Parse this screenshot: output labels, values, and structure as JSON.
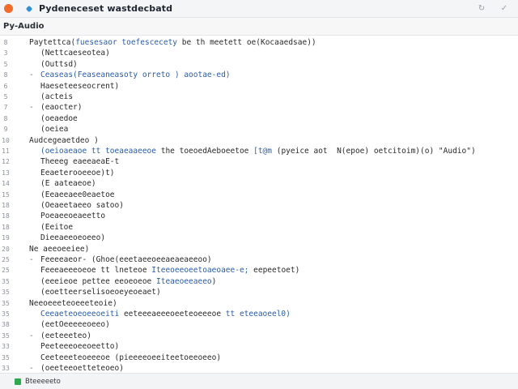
{
  "window": {
    "title": "Pydeneceset wastdecbatd",
    "refresh_glyph": "↻",
    "check_glyph": "✓"
  },
  "tab": {
    "label": "Py-Audio"
  },
  "editor": {
    "lines": [
      {
        "num": "8",
        "fold": "",
        "indent": 36,
        "segments": [
          {
            "t": "Paytettca(",
            "c": "plain"
          },
          {
            "t": "fuesesaor toefescecety",
            "c": "blue"
          },
          {
            "t": " be th meetett oe(Kocaaedsae))",
            "c": "plain"
          }
        ]
      },
      {
        "num": "3",
        "fold": "",
        "indent": 50,
        "segments": [
          {
            "t": "(Nettcaeseotea)",
            "c": "plain"
          }
        ]
      },
      {
        "num": "5",
        "fold": "",
        "indent": 50,
        "segments": [
          {
            "t": "(Outtsd)",
            "c": "plain"
          }
        ]
      },
      {
        "num": "8",
        "fold": "-",
        "indent": 50,
        "segments": [
          {
            "t": "Ceaseas(Feaseaneasoty orreto )",
            "c": "blue"
          },
          {
            "t": " ",
            "c": "plain"
          },
          {
            "t": "aootae-ed)",
            "c": "blue"
          }
        ]
      },
      {
        "num": "6",
        "fold": "",
        "indent": 50,
        "segments": [
          {
            "t": "Haeseteeseocrent)",
            "c": "plain"
          }
        ]
      },
      {
        "num": "5",
        "fold": "",
        "indent": 50,
        "segments": [
          {
            "t": "(acteis",
            "c": "plain"
          }
        ]
      },
      {
        "num": "7",
        "fold": "-",
        "indent": 50,
        "segments": [
          {
            "t": "(eaocter)",
            "c": "plain"
          }
        ]
      },
      {
        "num": "8",
        "fold": "",
        "indent": 50,
        "segments": [
          {
            "t": "(oeaedoe",
            "c": "plain"
          }
        ]
      },
      {
        "num": "9",
        "fold": "",
        "indent": 50,
        "segments": [
          {
            "t": "(oeiea",
            "c": "plain"
          }
        ]
      },
      {
        "num": "10",
        "fold": "",
        "indent": 36,
        "segments": [
          {
            "t": "Audcegeaetdeo )",
            "c": "plain"
          }
        ]
      },
      {
        "num": "11",
        "fold": "",
        "indent": 50,
        "segments": [
          {
            "t": "(oeioaeaoe tt toeaeaaeeoe",
            "c": "blue"
          },
          {
            "t": " the toeoedAeboeetoe",
            "c": "plain"
          },
          {
            "t": " [t@m",
            "c": "blue"
          },
          {
            "t": " (pyeice aot  N(epoe) oetcitoim)(o)",
            "c": "plain"
          },
          {
            "t": " \"Audio\")",
            "c": "plain"
          }
        ]
      },
      {
        "num": "12",
        "fold": "",
        "indent": 50,
        "segments": [
          {
            "t": "Theeeg eaeeaeaE-t",
            "c": "plain"
          }
        ]
      },
      {
        "num": "13",
        "fold": "",
        "indent": 50,
        "segments": [
          {
            "t": "Eeaeterooeeoe)t)",
            "c": "plain"
          }
        ]
      },
      {
        "num": "14",
        "fold": "",
        "indent": 50,
        "segments": [
          {
            "t": "(E aateaeoe)",
            "c": "plain"
          }
        ]
      },
      {
        "num": "15",
        "fold": "",
        "indent": 50,
        "segments": [
          {
            "t": "(Eeaeeaee0eaetoe",
            "c": "plain"
          }
        ]
      },
      {
        "num": "18",
        "fold": "",
        "indent": 50,
        "segments": [
          {
            "t": "(Oeaeetaeeo satoo)",
            "c": "plain"
          }
        ]
      },
      {
        "num": "18",
        "fold": "",
        "indent": 50,
        "segments": [
          {
            "t": "Poeaeeoeaeetto",
            "c": "plain"
          }
        ]
      },
      {
        "num": "18",
        "fold": "",
        "indent": 50,
        "segments": [
          {
            "t": "(Eeitoe",
            "c": "plain"
          }
        ]
      },
      {
        "num": "19",
        "fold": "",
        "indent": 50,
        "segments": [
          {
            "t": "Dieeaeeoeoeeo)",
            "c": "plain"
          }
        ]
      },
      {
        "num": "20",
        "fold": "",
        "indent": 36,
        "segments": [
          {
            "t": "Ne aeeoeeiee)",
            "c": "plain"
          }
        ]
      },
      {
        "num": "25",
        "fold": "-",
        "indent": 50,
        "segments": [
          {
            "t": "Feeeeaeor-",
            "c": "plain"
          },
          {
            "t": " (Ghoe(eeetaeeoeeaeaeaeeoo)",
            "c": "plain"
          }
        ]
      },
      {
        "num": "25",
        "fold": "",
        "indent": 50,
        "segments": [
          {
            "t": "Feeeaeeeoeoe tt lneteoe",
            "c": "plain"
          },
          {
            "t": " Iteeoeeoeetoaeoaee-e;",
            "c": "blue"
          },
          {
            "t": " eepeetoet)",
            "c": "plain"
          }
        ]
      },
      {
        "num": "35",
        "fold": "",
        "indent": 50,
        "segments": [
          {
            "t": "(eeeieoe pettee eeoeoeoe",
            "c": "plain"
          },
          {
            "t": " Iteaeoeeaeeo",
            "c": "blue"
          },
          {
            "t": ")",
            "c": "plain"
          }
        ]
      },
      {
        "num": "35",
        "fold": "",
        "indent": 50,
        "segments": [
          {
            "t": "(eoetteerselisoeoeyeoeaet)",
            "c": "plain"
          }
        ]
      },
      {
        "num": "35",
        "fold": "",
        "indent": 36,
        "segments": [
          {
            "t": "Neeoeeeteoeeeteoie)",
            "c": "plain"
          }
        ]
      },
      {
        "num": "35",
        "fold": "",
        "indent": 50,
        "segments": [
          {
            "t": "Ceeaeteoeoeeoeiti",
            "c": "blue"
          },
          {
            "t": " eeteeeaeeeoeeteoeeeoe",
            "c": "plain"
          },
          {
            "t": " tt eteeaoeel0)",
            "c": "blue"
          }
        ]
      },
      {
        "num": "38",
        "fold": "",
        "indent": 50,
        "segments": [
          {
            "t": "(eetOeeeeeoeeo)",
            "c": "plain"
          }
        ]
      },
      {
        "num": "35",
        "fold": "-",
        "indent": 50,
        "segments": [
          {
            "t": "(eeteeeteo)",
            "c": "plain"
          }
        ]
      },
      {
        "num": "33",
        "fold": "",
        "indent": 50,
        "segments": [
          {
            "t": "Peeteeeoeeoeetto)",
            "c": "plain"
          }
        ]
      },
      {
        "num": "35",
        "fold": "",
        "indent": 50,
        "segments": [
          {
            "t": "Ceeteeeteoeeeoe",
            "c": "plain"
          },
          {
            "t": " (pieeeeoeeiteetoeeoeeo)",
            "c": "plain"
          }
        ]
      },
      {
        "num": "33",
        "fold": "-",
        "indent": 50,
        "segments": [
          {
            "t": "(oeeteeoetteteoeo)",
            "c": "plain"
          }
        ]
      }
    ]
  },
  "status": {
    "label": "Bteeeeeto"
  }
}
